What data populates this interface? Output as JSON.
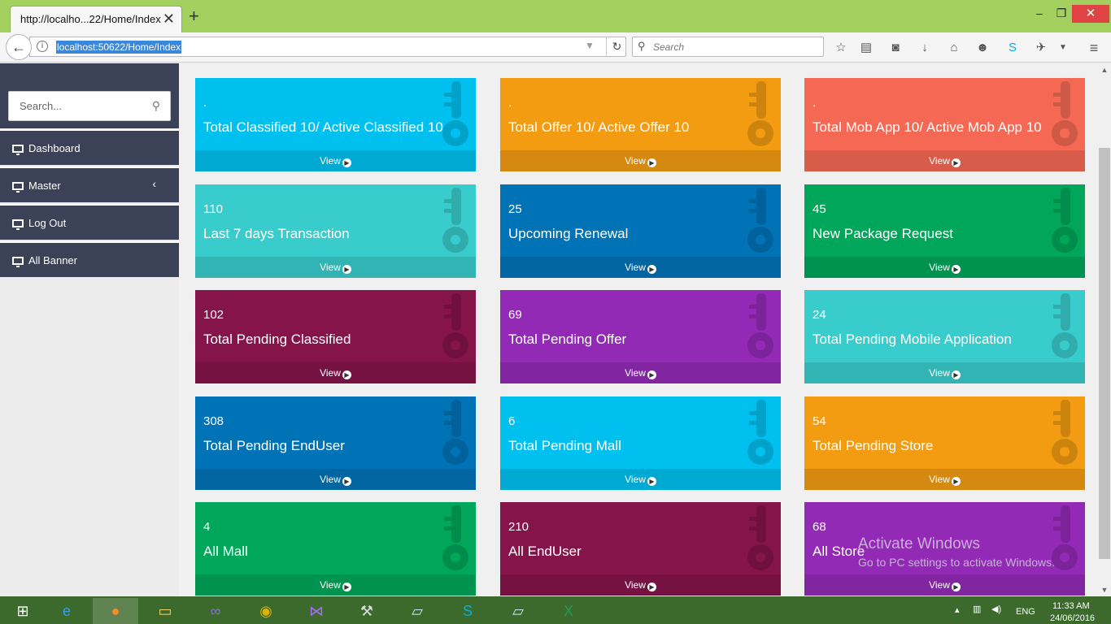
{
  "browser": {
    "tab_title": "http://localho...22/Home/Index",
    "url": "localhost:50622/Home/Index",
    "search_placeholder": "Search"
  },
  "sidebar": {
    "search_placeholder": "Search...",
    "items": [
      {
        "label": "Dashboard"
      },
      {
        "label": "Master"
      },
      {
        "label": "Log Out"
      },
      {
        "label": "All Banner"
      }
    ]
  },
  "cards": [
    {
      "num": ".",
      "label": "Total Classified 10/ Active Classified 10",
      "view": "View",
      "color": "#00c0ef"
    },
    {
      "num": ".",
      "label": "Total Offer 10/ Active Offer 10",
      "view": "View",
      "color": "#f39c12"
    },
    {
      "num": ".",
      "label": "Total Mob App 10/ Active Mob App 10",
      "view": "View",
      "color": "#f56954"
    },
    {
      "num": "110",
      "label": "Last 7 days Transaction",
      "view": "View",
      "color": "#39cccc"
    },
    {
      "num": "25",
      "label": "Upcoming Renewal",
      "view": "View",
      "color": "#0073b7"
    },
    {
      "num": "45",
      "label": "New Package Request",
      "view": "View",
      "color": "#00a65a"
    },
    {
      "num": "102",
      "label": "Total Pending Classified",
      "view": "View",
      "color": "#85144b"
    },
    {
      "num": "69",
      "label": "Total Pending Offer",
      "view": "View",
      "color": "#932ab6"
    },
    {
      "num": "24",
      "label": "Total Pending Mobile Application",
      "view": "View",
      "color": "#39cccc"
    },
    {
      "num": "308",
      "label": "Total Pending EndUser",
      "view": "View",
      "color": "#0073b7"
    },
    {
      "num": "6",
      "label": "Total Pending Mall",
      "view": "View",
      "color": "#00c0ef"
    },
    {
      "num": "54",
      "label": "Total Pending Store",
      "view": "View",
      "color": "#f39c12"
    },
    {
      "num": "4",
      "label": "All Mall",
      "view": "View",
      "color": "#00a65a"
    },
    {
      "num": "210",
      "label": "All EndUser",
      "view": "View",
      "color": "#85144b"
    },
    {
      "num": "68",
      "label": "All Store",
      "view": "View",
      "color": "#932ab6"
    }
  ],
  "watermark": {
    "line1": "Activate Windows",
    "line2": "Go to PC settings to activate Windows."
  },
  "taskbar": {
    "lang": "ENG",
    "time": "11:33 AM",
    "date": "24/06/2016"
  }
}
